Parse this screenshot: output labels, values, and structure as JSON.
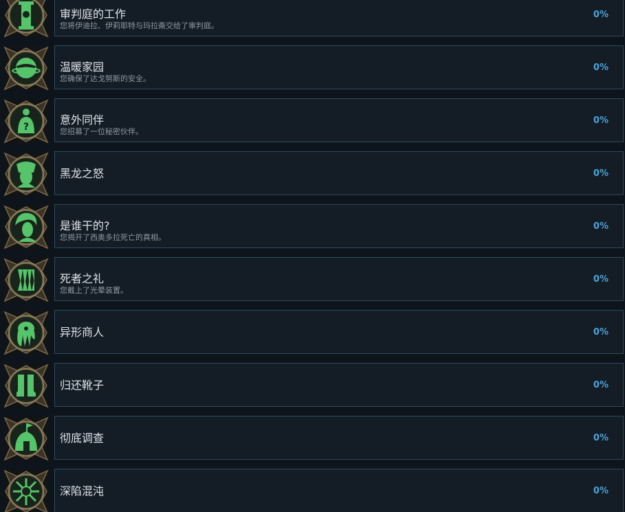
{
  "achievements": [
    {
      "title": "审判庭的工作",
      "desc": "您将伊迪拉、伊莉耶特与玛拉斋交给了审判庭。",
      "percent": "0%",
      "icon": "skull-pillar-icon"
    },
    {
      "title": "温暖家园",
      "desc": "您确保了达戈努斯的安全。",
      "percent": "0%",
      "icon": "aquila-planet-icon"
    },
    {
      "title": "意外同伴",
      "desc": "您招募了一位秘密伙伴。",
      "percent": "0%",
      "icon": "mystery-companion-icon"
    },
    {
      "title": "黑龙之怒",
      "desc": "",
      "percent": "0%",
      "icon": "dark-eldar-face-icon"
    },
    {
      "title": "是谁干的?",
      "desc": "您揭开了西奥多拉死亡的真相。",
      "percent": "0%",
      "icon": "hooded-woman-icon"
    },
    {
      "title": "死者之礼",
      "desc": "您戴上了光晕装置。",
      "percent": "0%",
      "icon": "fanged-maw-icon"
    },
    {
      "title": "异形商人",
      "desc": "",
      "percent": "0%",
      "icon": "xenos-merchant-icon"
    },
    {
      "title": "归还靴子",
      "desc": "",
      "percent": "0%",
      "icon": "boots-icon"
    },
    {
      "title": "彻底调查",
      "desc": "",
      "percent": "0%",
      "icon": "tent-flag-icon"
    },
    {
      "title": "深陷混沌",
      "desc": "",
      "percent": "0%",
      "icon": "chaos-star-icon"
    }
  ],
  "colors": {
    "accent": "#4ba3d9",
    "icon_green": "#56c46a",
    "card_bg": "#141d26",
    "card_border": "#2c4b5c"
  }
}
